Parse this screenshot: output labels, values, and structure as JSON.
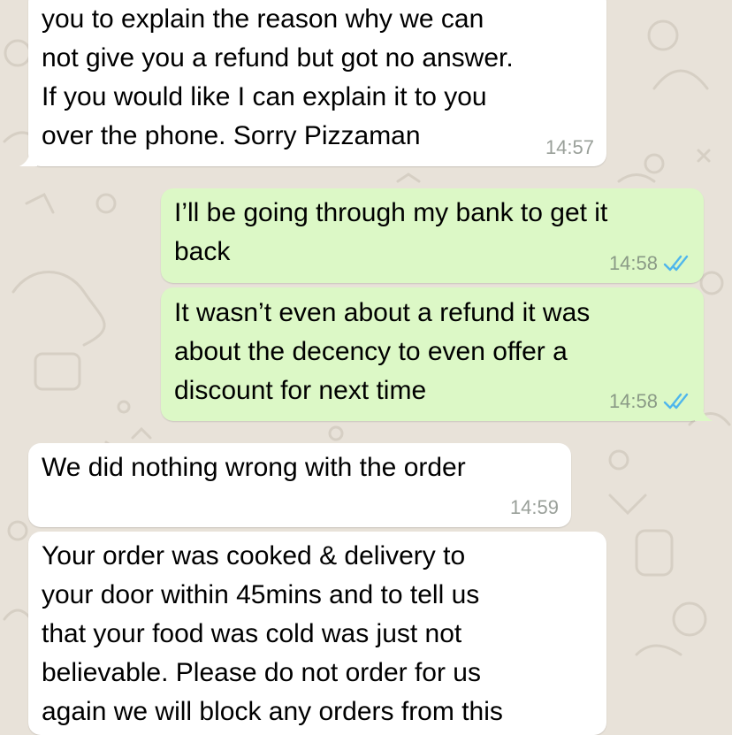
{
  "colors": {
    "background": "#e8e2d9",
    "incoming_bubble": "#ffffff",
    "outgoing_bubble": "#dcf8c6",
    "read_ticks": "#4fb6ec",
    "timestamp": "#9aa09a"
  },
  "messages": [
    {
      "direction": "incoming",
      "text": "you to explain the reason why we can\nnot give you a refund but got no answer.\nIf you would like I can explain it to you\nover the phone. Sorry Pizzaman",
      "time": "14:57"
    },
    {
      "direction": "outgoing",
      "text": "I’ll be going through my bank to get it\nback",
      "time": "14:58",
      "status_icon": "double-check-read-icon"
    },
    {
      "direction": "outgoing",
      "text": "It wasn’t even about a refund it was\nabout the decency to even offer a\ndiscount for next time",
      "time": "14:58",
      "status_icon": "double-check-read-icon"
    },
    {
      "direction": "incoming",
      "text": "We did nothing wrong with the order",
      "time": "14:59"
    },
    {
      "direction": "incoming",
      "text": "Your order was cooked & delivery to\nyour door within 45mins and to tell us\nthat your food was cold was just not\nbelievable. Please do not order for us\nagain we will block any orders from this",
      "time": ""
    }
  ]
}
